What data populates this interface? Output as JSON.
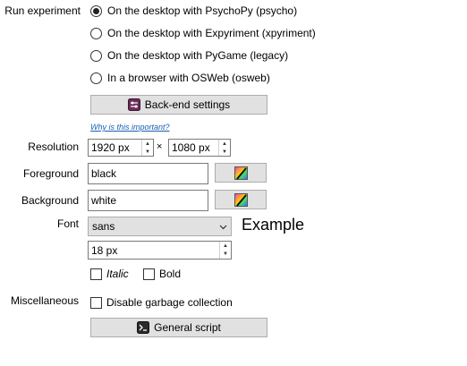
{
  "run_experiment": {
    "label": "Run experiment",
    "options": [
      {
        "label": "On the desktop with PsychoPy (psycho)",
        "checked": true
      },
      {
        "label": "On the desktop with Expyriment (xpyriment)",
        "checked": false
      },
      {
        "label": "On the desktop with PyGame (legacy)",
        "checked": false
      },
      {
        "label": "In a browser with OSWeb (osweb)",
        "checked": false
      }
    ]
  },
  "backend_button": {
    "label": "Back-end settings",
    "icon": "settings-icon"
  },
  "help_link": {
    "label": "Why is this important?"
  },
  "resolution": {
    "label": "Resolution",
    "width": "1920 px",
    "separator": "×",
    "height": "1080 px"
  },
  "foreground": {
    "label": "Foreground",
    "value": "black",
    "icon": "color-picker-icon"
  },
  "background": {
    "label": "Background",
    "value": "white",
    "icon": "color-picker-icon"
  },
  "font": {
    "label": "Font",
    "family": "sans",
    "example": "Example",
    "size": "18 px",
    "italic_label": "Italic",
    "bold_label": "Bold",
    "italic_checked": false,
    "bold_checked": false
  },
  "misc": {
    "label": "Miscellaneous",
    "garbage_label": "Disable garbage collection",
    "garbage_checked": false
  },
  "general_script_button": {
    "label": "General script",
    "icon": "terminal-icon"
  }
}
